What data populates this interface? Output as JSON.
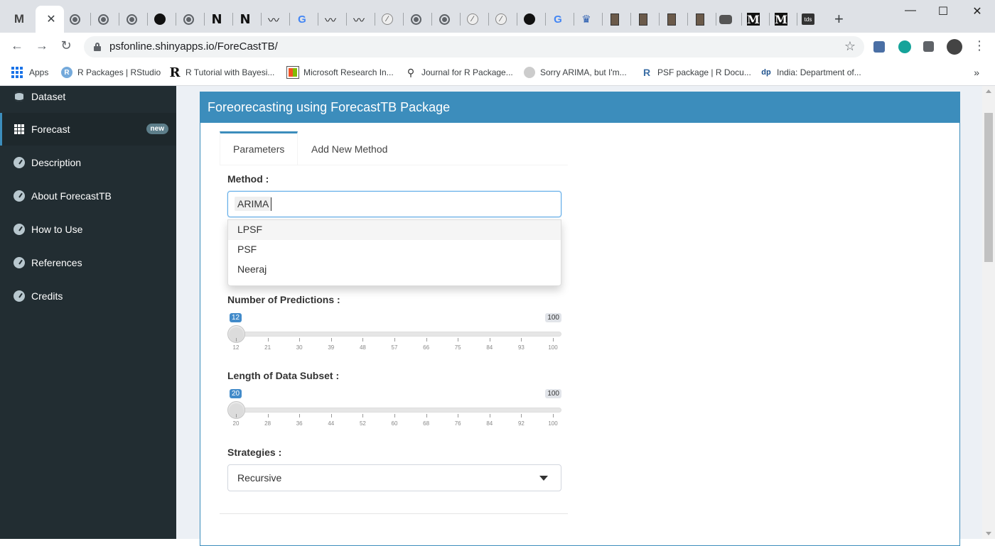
{
  "browser": {
    "tab_close": "✕",
    "new_tab": "+",
    "window_controls": [
      "—",
      "☐",
      "✕"
    ],
    "url": "psfonline.shinyapps.io/ForeCastTB/",
    "bookmarks": [
      {
        "label": "Apps",
        "icon": "apps-grid-icon"
      },
      {
        "label": "R Packages | RStudio",
        "icon": "r-logo-icon"
      },
      {
        "label": "R Tutorial with Bayesi...",
        "icon": "r-letter-icon"
      },
      {
        "label": "Microsoft Research In...",
        "icon": "microsoft-icon"
      },
      {
        "label": "Journal for R Package...",
        "icon": "journal-icon"
      },
      {
        "label": "Sorry ARIMA, but I'm...",
        "icon": "medium-icon"
      },
      {
        "label": "PSF package | R Docu...",
        "icon": "rdocs-icon"
      },
      {
        "label": "India: Department of...",
        "icon": "dp-icon"
      }
    ],
    "bookmark_more": "»"
  },
  "sidebar": {
    "items": [
      {
        "label": "Dataset",
        "icon": "database-icon"
      },
      {
        "label": "Forecast",
        "icon": "table-grid-icon",
        "badge": "new"
      },
      {
        "label": "Description",
        "icon": "dashboard-icon"
      },
      {
        "label": "About ForecastTB",
        "icon": "dashboard-icon"
      },
      {
        "label": "How to Use",
        "icon": "dashboard-icon"
      },
      {
        "label": "References",
        "icon": "dashboard-icon"
      },
      {
        "label": "Credits",
        "icon": "dashboard-icon"
      }
    ]
  },
  "main": {
    "title": "Foreorecasting using ForecastTB Package",
    "tabs": [
      {
        "label": "Parameters",
        "active": true
      },
      {
        "label": "Add New Method",
        "active": false
      }
    ],
    "method": {
      "label": "Method :",
      "selected": "ARIMA",
      "options": [
        "LPSF",
        "PSF",
        "Neeraj"
      ]
    },
    "predictions": {
      "label": "Number of Predictions :",
      "min": 12,
      "max": 100,
      "value": 12,
      "value_label": "12",
      "max_label": "100",
      "ticks": [
        "12",
        "21",
        "30",
        "39",
        "48",
        "57",
        "66",
        "75",
        "84",
        "93",
        "100"
      ]
    },
    "subset": {
      "label": "Length of Data Subset :",
      "min": 20,
      "max": 100,
      "value": 20,
      "value_label": "20",
      "max_label": "100",
      "ticks": [
        "20",
        "28",
        "36",
        "44",
        "52",
        "60",
        "68",
        "76",
        "84",
        "92",
        "100"
      ]
    },
    "strategies": {
      "label": "Strategies :",
      "selected": "Recursive"
    }
  },
  "colors": {
    "accent": "#3c8dbc",
    "sidebar_bg": "#222d32",
    "slider_bubble": "#428bca"
  }
}
